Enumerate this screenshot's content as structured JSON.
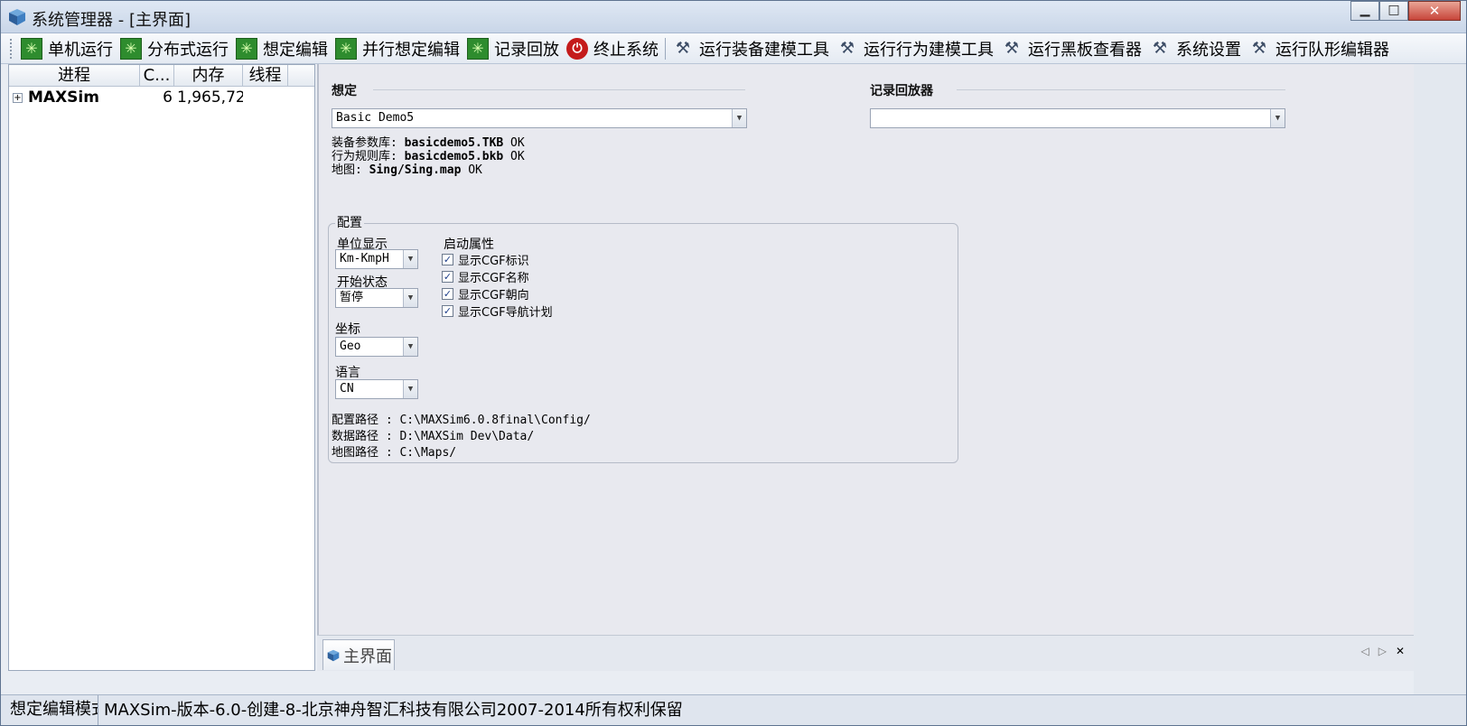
{
  "window": {
    "title": "系统管理器 - [主界面]"
  },
  "toolbar": {
    "items": [
      {
        "label": "单机运行",
        "icon": "green-star-icon"
      },
      {
        "label": "分布式运行",
        "icon": "green-star-icon"
      },
      {
        "label": "想定编辑",
        "icon": "green-star-icon"
      },
      {
        "label": "并行想定编辑",
        "icon": "green-star-icon"
      },
      {
        "label": "记录回放",
        "icon": "green-star-icon"
      },
      {
        "label": "终止系统",
        "icon": "power-stop-icon"
      },
      {
        "label": "运行装备建模工具",
        "icon": "tools-icon"
      },
      {
        "label": "运行行为建模工具",
        "icon": "tools-icon"
      },
      {
        "label": "运行黑板查看器",
        "icon": "tools-icon"
      },
      {
        "label": "系统设置",
        "icon": "tools-icon"
      },
      {
        "label": "运行队形编辑器",
        "icon": "tools-icon"
      }
    ]
  },
  "process_table": {
    "columns": [
      "进程",
      "C...",
      "内存",
      "线程"
    ],
    "rows": [
      {
        "name": "MAXSim",
        "c": "6",
        "memory": "1,965,72",
        "threads": ""
      }
    ]
  },
  "scenario": {
    "section_title": "想定",
    "selected": "Basic Demo5",
    "equipment_db_label": "装备参数库: ",
    "equipment_db_value": "basicdemo5.TKB",
    "equipment_db_status": " OK",
    "behavior_db_label": "行为规则库: ",
    "behavior_db_value": "basicdemo5.bkb",
    "behavior_db_status": " OK",
    "map_label": "地图: ",
    "map_value": "Sing/Sing.map",
    "map_status": " OK"
  },
  "replayer": {
    "section_title": "记录回放器",
    "selected": ""
  },
  "config": {
    "title": "配置",
    "unit_display_label": "单位显示",
    "unit_display_value": "Km-KmpH",
    "start_state_label": "开始状态",
    "start_state_value": "暂停",
    "coordinate_label": "坐标",
    "coordinate_value": "Geo",
    "language_label": "语言",
    "language_value": "CN",
    "startup_props_label": "启动属性",
    "checkboxes": [
      {
        "label": "显示CGF标识",
        "checked": true
      },
      {
        "label": "显示CGF名称",
        "checked": true
      },
      {
        "label": "显示CGF朝向",
        "checked": true
      },
      {
        "label": "显示CGF导航计划",
        "checked": true
      }
    ],
    "config_path": "配置路径 : C:\\MAXSim6.0.8final\\Config/",
    "data_path": "数据路径 : D:\\MAXSim Dev\\Data/",
    "map_path": "地图路径 : C:\\Maps/"
  },
  "tabs": {
    "main_label": "主界面"
  },
  "status": {
    "left": "想定编辑模式",
    "right": "MAXSim-版本-6.0-创建-8-北京神舟智汇科技有限公司2007-2014所有权利保留"
  }
}
